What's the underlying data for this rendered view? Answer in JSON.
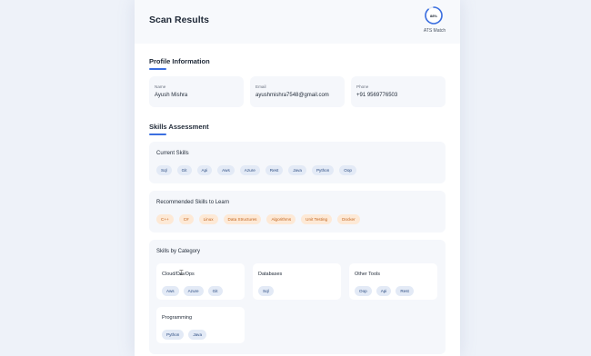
{
  "header": {
    "title": "Scan Results",
    "ats_percent": "88%",
    "ats_fraction": 0.88,
    "ats_label": "ATS Match"
  },
  "profile": {
    "section_title": "Profile Information",
    "fields": [
      {
        "label": "Name",
        "value": "Ayush Mishra"
      },
      {
        "label": "Email",
        "value": "ayushmishra7548@gmail.com"
      },
      {
        "label": "Phone",
        "value": "+91 9569776503"
      }
    ]
  },
  "skills": {
    "section_title": "Skills Assessment",
    "current": {
      "title": "Current Skills",
      "items": [
        "Sql",
        "Git",
        "Api",
        "Aws",
        "Azure",
        "Rest",
        "Java",
        "Python",
        "Oop"
      ]
    },
    "recommended": {
      "title": "Recommended Skills to Learn",
      "items": [
        "C++",
        "C#",
        "Linux",
        "Data Structures",
        "Algorithms",
        "Unit Testing",
        "Docker"
      ]
    },
    "by_category": {
      "title": "Skills by Category",
      "categories": [
        {
          "name": "Cloud/DevOps",
          "items": [
            "Aws",
            "Azure",
            "Git"
          ]
        },
        {
          "name": "Databases",
          "items": [
            "Sql"
          ]
        },
        {
          "name": "Other Tools",
          "items": [
            "Oop",
            "Api",
            "Rest"
          ]
        },
        {
          "name": "Programming",
          "items": [
            "Python",
            "Java"
          ]
        }
      ]
    }
  },
  "colors": {
    "accent": "#3b6fe0",
    "chip_blue": "#e3eaf6",
    "chip_orange": "#fde9d6"
  }
}
